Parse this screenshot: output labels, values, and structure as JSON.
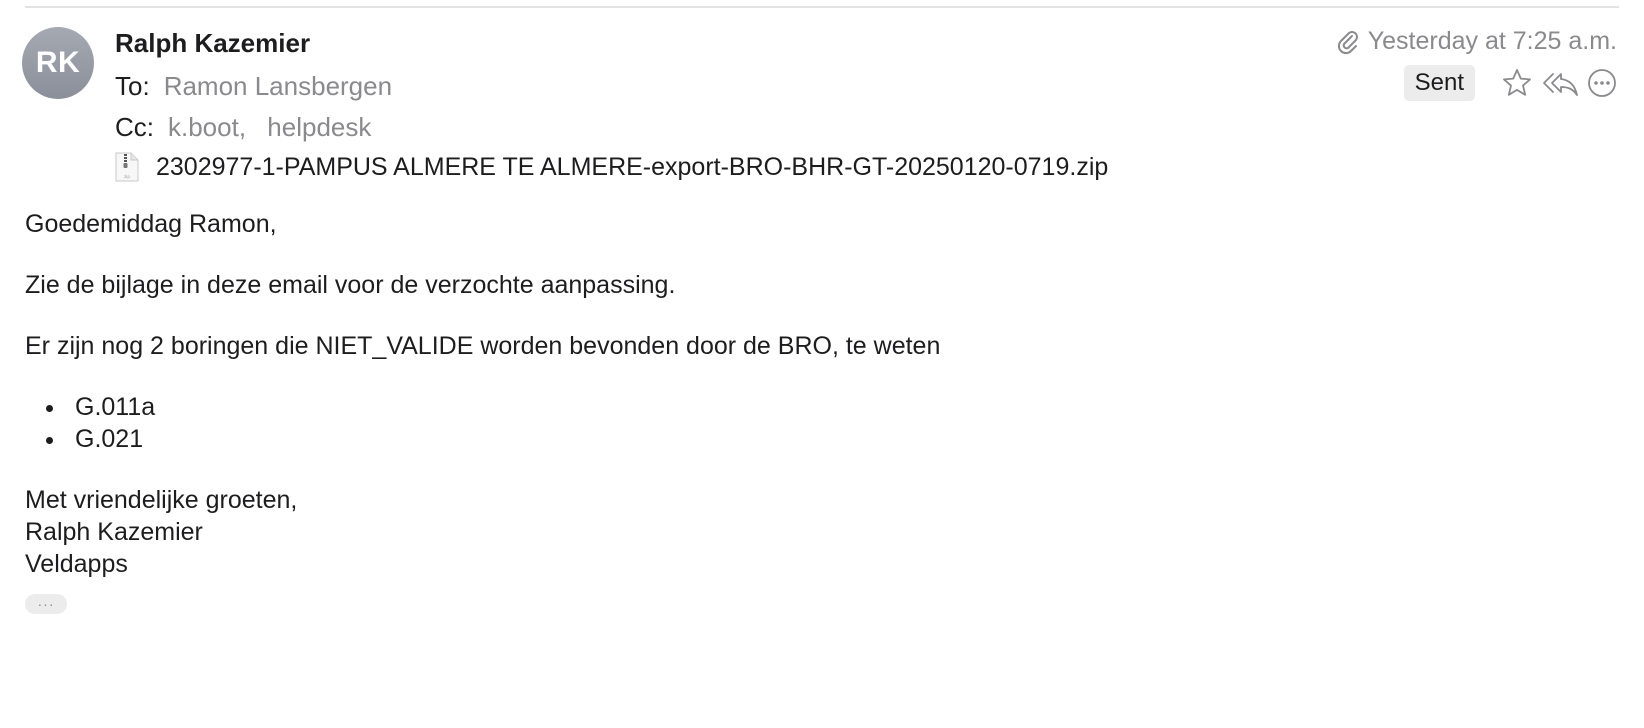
{
  "message": {
    "avatar_initials": "RK",
    "sender": "Ralph Kazemier",
    "to_label": "To:",
    "to_value": "Ramon Lansbergen",
    "cc_label": "Cc:",
    "cc_values": [
      "k.boot,",
      "helpdesk"
    ],
    "attachment_name": "2302977-1-PAMPUS ALMERE TE ALMERE-export-BRO-BHR-GT-20250120-0719.zip",
    "date": "Yesterday at 7:25 a.m.",
    "sent_badge": "Sent",
    "icons": {
      "attachment": "paperclip-icon",
      "file": "zip-file-icon",
      "flag": "star-icon",
      "reply_all": "reply-all-icon",
      "more": "more-icon"
    },
    "more_pill": "···"
  },
  "body": {
    "greeting": "Goedemiddag Ramon,",
    "line1": "Zie de bijlage in deze email voor de verzochte aanpassing.",
    "line2": "Er zijn nog 2 boringen die NIET_VALIDE worden bevonden door de BRO, te weten",
    "bullets": [
      "G.011a",
      "G.021"
    ],
    "closing": "Met vriendelijke groeten,",
    "signature_name": "Ralph Kazemier",
    "signature_company": "Veldapps"
  },
  "colors": {
    "avatar_bg": "#9a9ea7",
    "muted_text": "#8a8a8e",
    "badge_bg": "#ececec"
  }
}
